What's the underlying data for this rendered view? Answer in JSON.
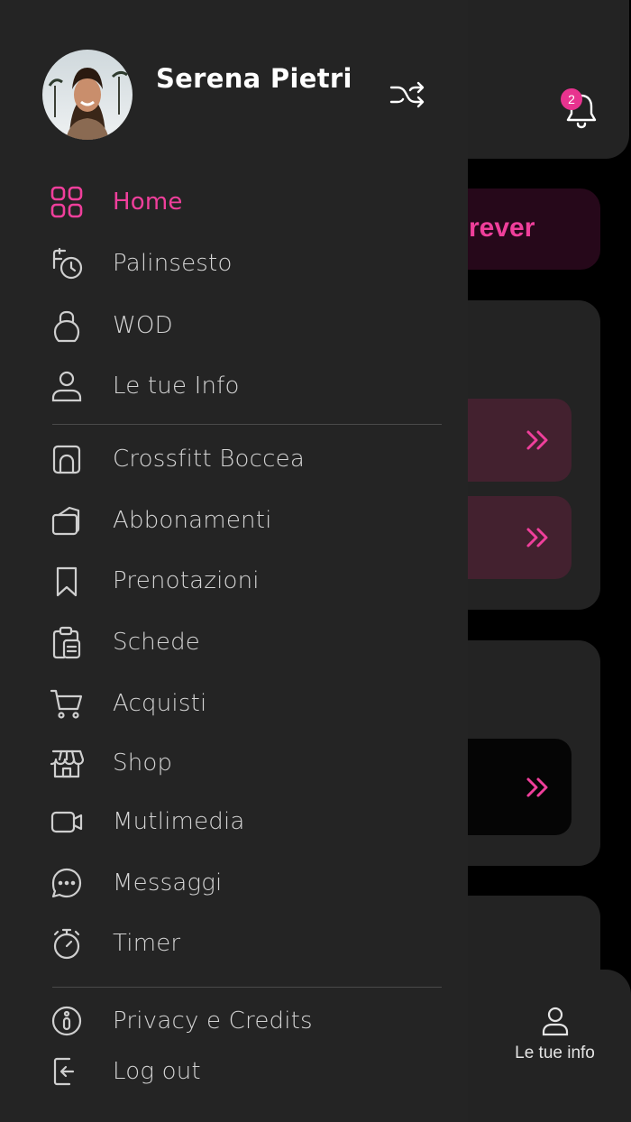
{
  "user": {
    "name": "Serena Pietri"
  },
  "notifications": {
    "count": "2"
  },
  "background": {
    "banner_text": "rever",
    "bottom_nav": {
      "label": "Le tue info"
    }
  },
  "menu": {
    "primary": [
      {
        "label": "Home",
        "icon": "grid-icon",
        "active": true
      },
      {
        "label": "Palinsesto",
        "icon": "schedule-history-icon"
      },
      {
        "label": "WOD",
        "icon": "kettlebell-icon"
      },
      {
        "label": "Le tue Info",
        "icon": "user-icon"
      }
    ],
    "secondary": [
      {
        "label": "Crossfitt Boccea",
        "icon": "gym-icon"
      },
      {
        "label": "Abbonamenti",
        "icon": "subscription-card-icon"
      },
      {
        "label": "Prenotazioni",
        "icon": "bookmark-icon"
      },
      {
        "label": "Schede",
        "icon": "clipboard-icon"
      },
      {
        "label": "Acquisti",
        "icon": "cart-icon"
      },
      {
        "label": "Shop",
        "icon": "store-icon"
      },
      {
        "label": "Mutlimedia",
        "icon": "video-icon"
      },
      {
        "label": "Messaggi",
        "icon": "chat-icon"
      },
      {
        "label": "Timer",
        "icon": "stopwatch-icon"
      }
    ],
    "footer": [
      {
        "label": "Privacy e Credits",
        "icon": "info-icon"
      },
      {
        "label": "Log out",
        "icon": "logout-icon"
      }
    ]
  },
  "colors": {
    "accent": "#ef3f9b",
    "drawer_bg": "#242424",
    "text": "#d4d4d4"
  }
}
